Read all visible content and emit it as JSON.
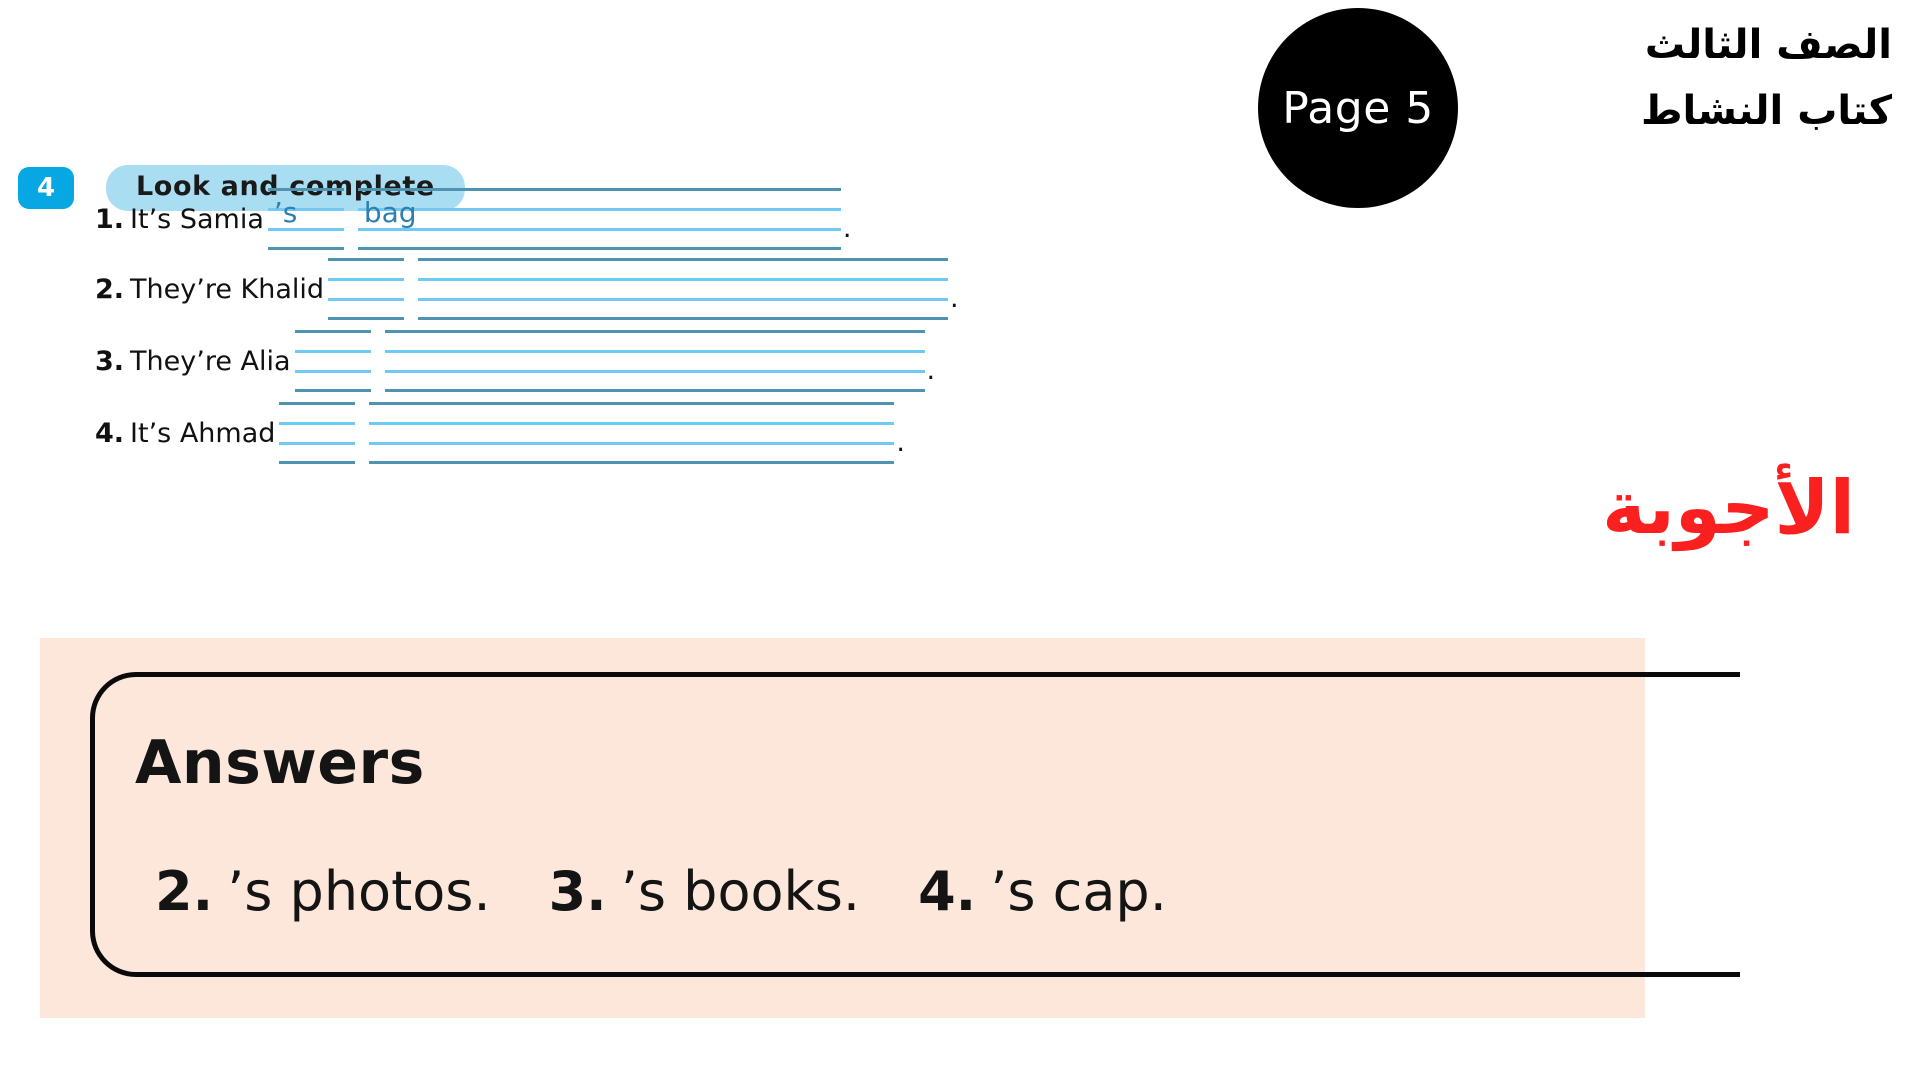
{
  "header": {
    "arabic_lines": [
      "الصف الثالث",
      "كتاب النشاط"
    ],
    "page_badge_label": "Page 5",
    "badge_bg_color": "#000000",
    "badge_text_color": "#ffffff"
  },
  "exercise": {
    "number": "4",
    "number_bg_color": "#06A7E2",
    "title": "Look and complete",
    "title_pill_color": "#A8DDF2",
    "items": [
      {
        "index": "1.",
        "prompt": "It’s Samia",
        "short_blank": "’s",
        "long_blank": "bag",
        "period": "."
      },
      {
        "index": "2.",
        "prompt": "They’re Khalid",
        "short_blank": "",
        "long_blank": "",
        "period": "."
      },
      {
        "index": "3.",
        "prompt": "They’re Alia",
        "short_blank": "",
        "long_blank": "",
        "period": "."
      },
      {
        "index": "4.",
        "prompt": "It’s Ahmad",
        "short_blank": "",
        "long_blank": "",
        "period": "."
      }
    ]
  },
  "answers_label_arabic": {
    "text": "الأجوبة",
    "color": "#FB2020"
  },
  "answers_box": {
    "title": "Answers",
    "bg_color": "#FDE7DA",
    "border_color": "#0a0a0a",
    "items": [
      {
        "number": "2.",
        "value": "’s photos."
      },
      {
        "number": "3.",
        "value": "’s books."
      },
      {
        "number": "4.",
        "value": "’s cap."
      }
    ]
  }
}
